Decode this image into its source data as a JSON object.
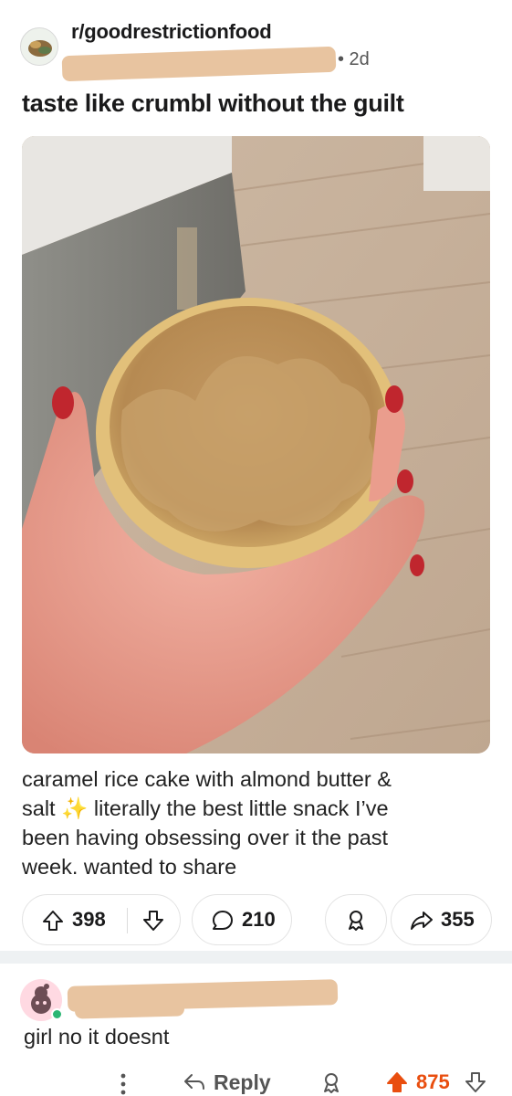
{
  "post": {
    "subreddit": "r/goodrestrictionfood",
    "age": "• 2d",
    "title": "taste like crumbl without the guilt",
    "body_line1": "caramel rice cake with almond butter &",
    "body_line2a": "salt ",
    "body_sparkle": "✨",
    "body_line2b": " literally the best little snack I’ve",
    "body_line3": "been having obsessing over it the past",
    "body_line4": "week. wanted to share",
    "image_alt": "hand holding a rice cake spread with almond butter"
  },
  "actions": {
    "upvotes": "398",
    "comments": "210",
    "shares": "355"
  },
  "comment": {
    "text": "girl no it doesnt",
    "reply_label": "Reply",
    "score": "875"
  },
  "colors": {
    "upvote_active": "#e94e0f",
    "redaction": "#e8c4a0",
    "online": "#2bb673"
  },
  "icons": [
    "subreddit-avatar-icon",
    "upvote-icon",
    "downvote-icon",
    "comment-icon",
    "award-icon",
    "share-icon",
    "more-icon",
    "reply-icon"
  ]
}
